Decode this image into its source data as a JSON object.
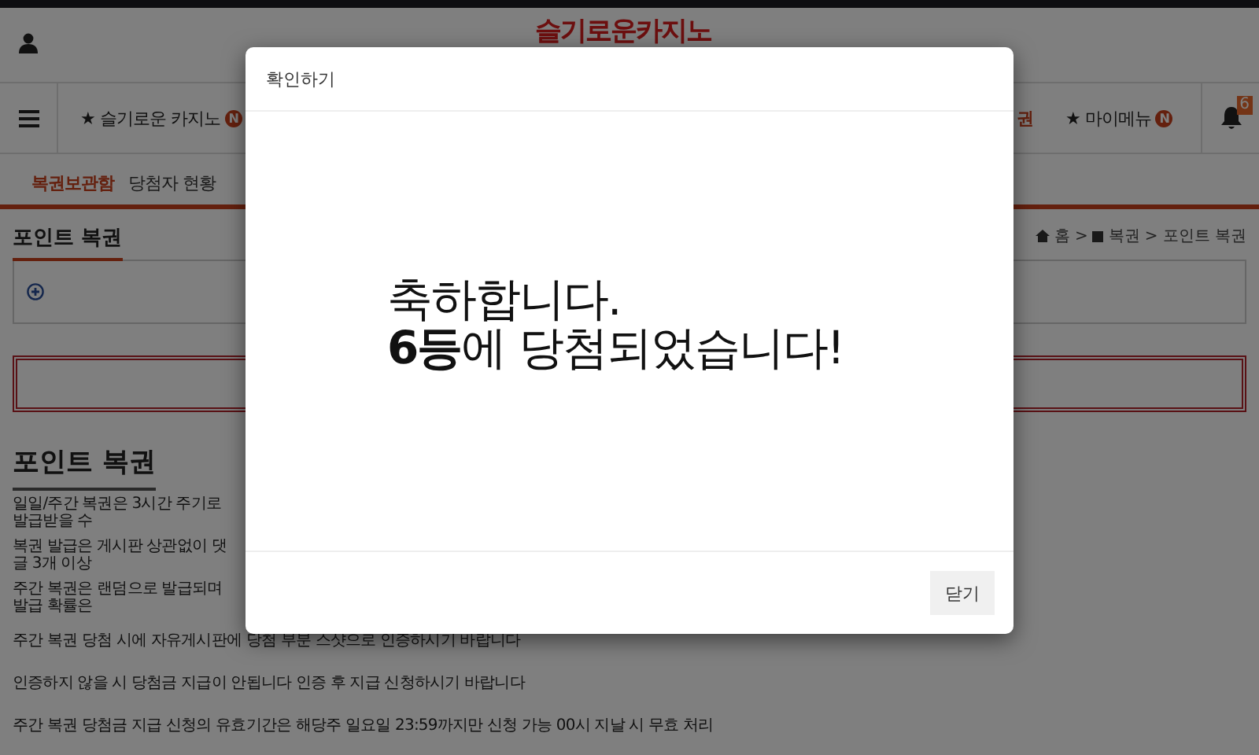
{
  "header": {
    "logo": "슬기로운카지노"
  },
  "nav": {
    "items": [
      {
        "label": "★ 슬기로운 카지노",
        "badge": "N"
      },
      {
        "label": "권"
      },
      {
        "label": "★ 마이메뉴",
        "badge": "N"
      }
    ],
    "notification_count": "6"
  },
  "tabs": [
    {
      "label": "복권보관함",
      "selected": true
    },
    {
      "label": "당첨자 현황",
      "selected": false
    }
  ],
  "section_title": "포인트 복권",
  "breadcrumb": [
    "홈",
    ">",
    "복권",
    ">",
    "포인트 복권"
  ],
  "heading": "포인트 복권",
  "notices": [
    {
      "text": "일일/주간 복권은 3시간 주기로 발급받을 수",
      "cut": true
    },
    {
      "text": "복권 발급은 게시판 상관없이 댓글 3개 이상",
      "cut": true
    },
    {
      "text": "주간 복권은 랜덤으로 발급되며 발급 확률은",
      "cut": true
    },
    {
      "text": "주간 복권 당첨 시에 자유게시판에 당첨 부분 스샷으로 인증하시기 바랍니다",
      "cut": false
    },
    {
      "text": "인증하지 않을 시 당첨금 지급이 안됩니다 인증 후 지급 신청하시기 바랍니다",
      "cut": false
    },
    {
      "text": "주간 복권 당첨금 지급 신청의 유효기간은 해당주 일요일 23:59까지만 신청 가능 00시 지날 시 무효 처리",
      "cut": false
    }
  ],
  "dialog": {
    "title": "확인하기",
    "message": [
      "축하합니다.",
      "**6등**에 당첨되었습니다!"
    ],
    "close_button": "닫기"
  }
}
